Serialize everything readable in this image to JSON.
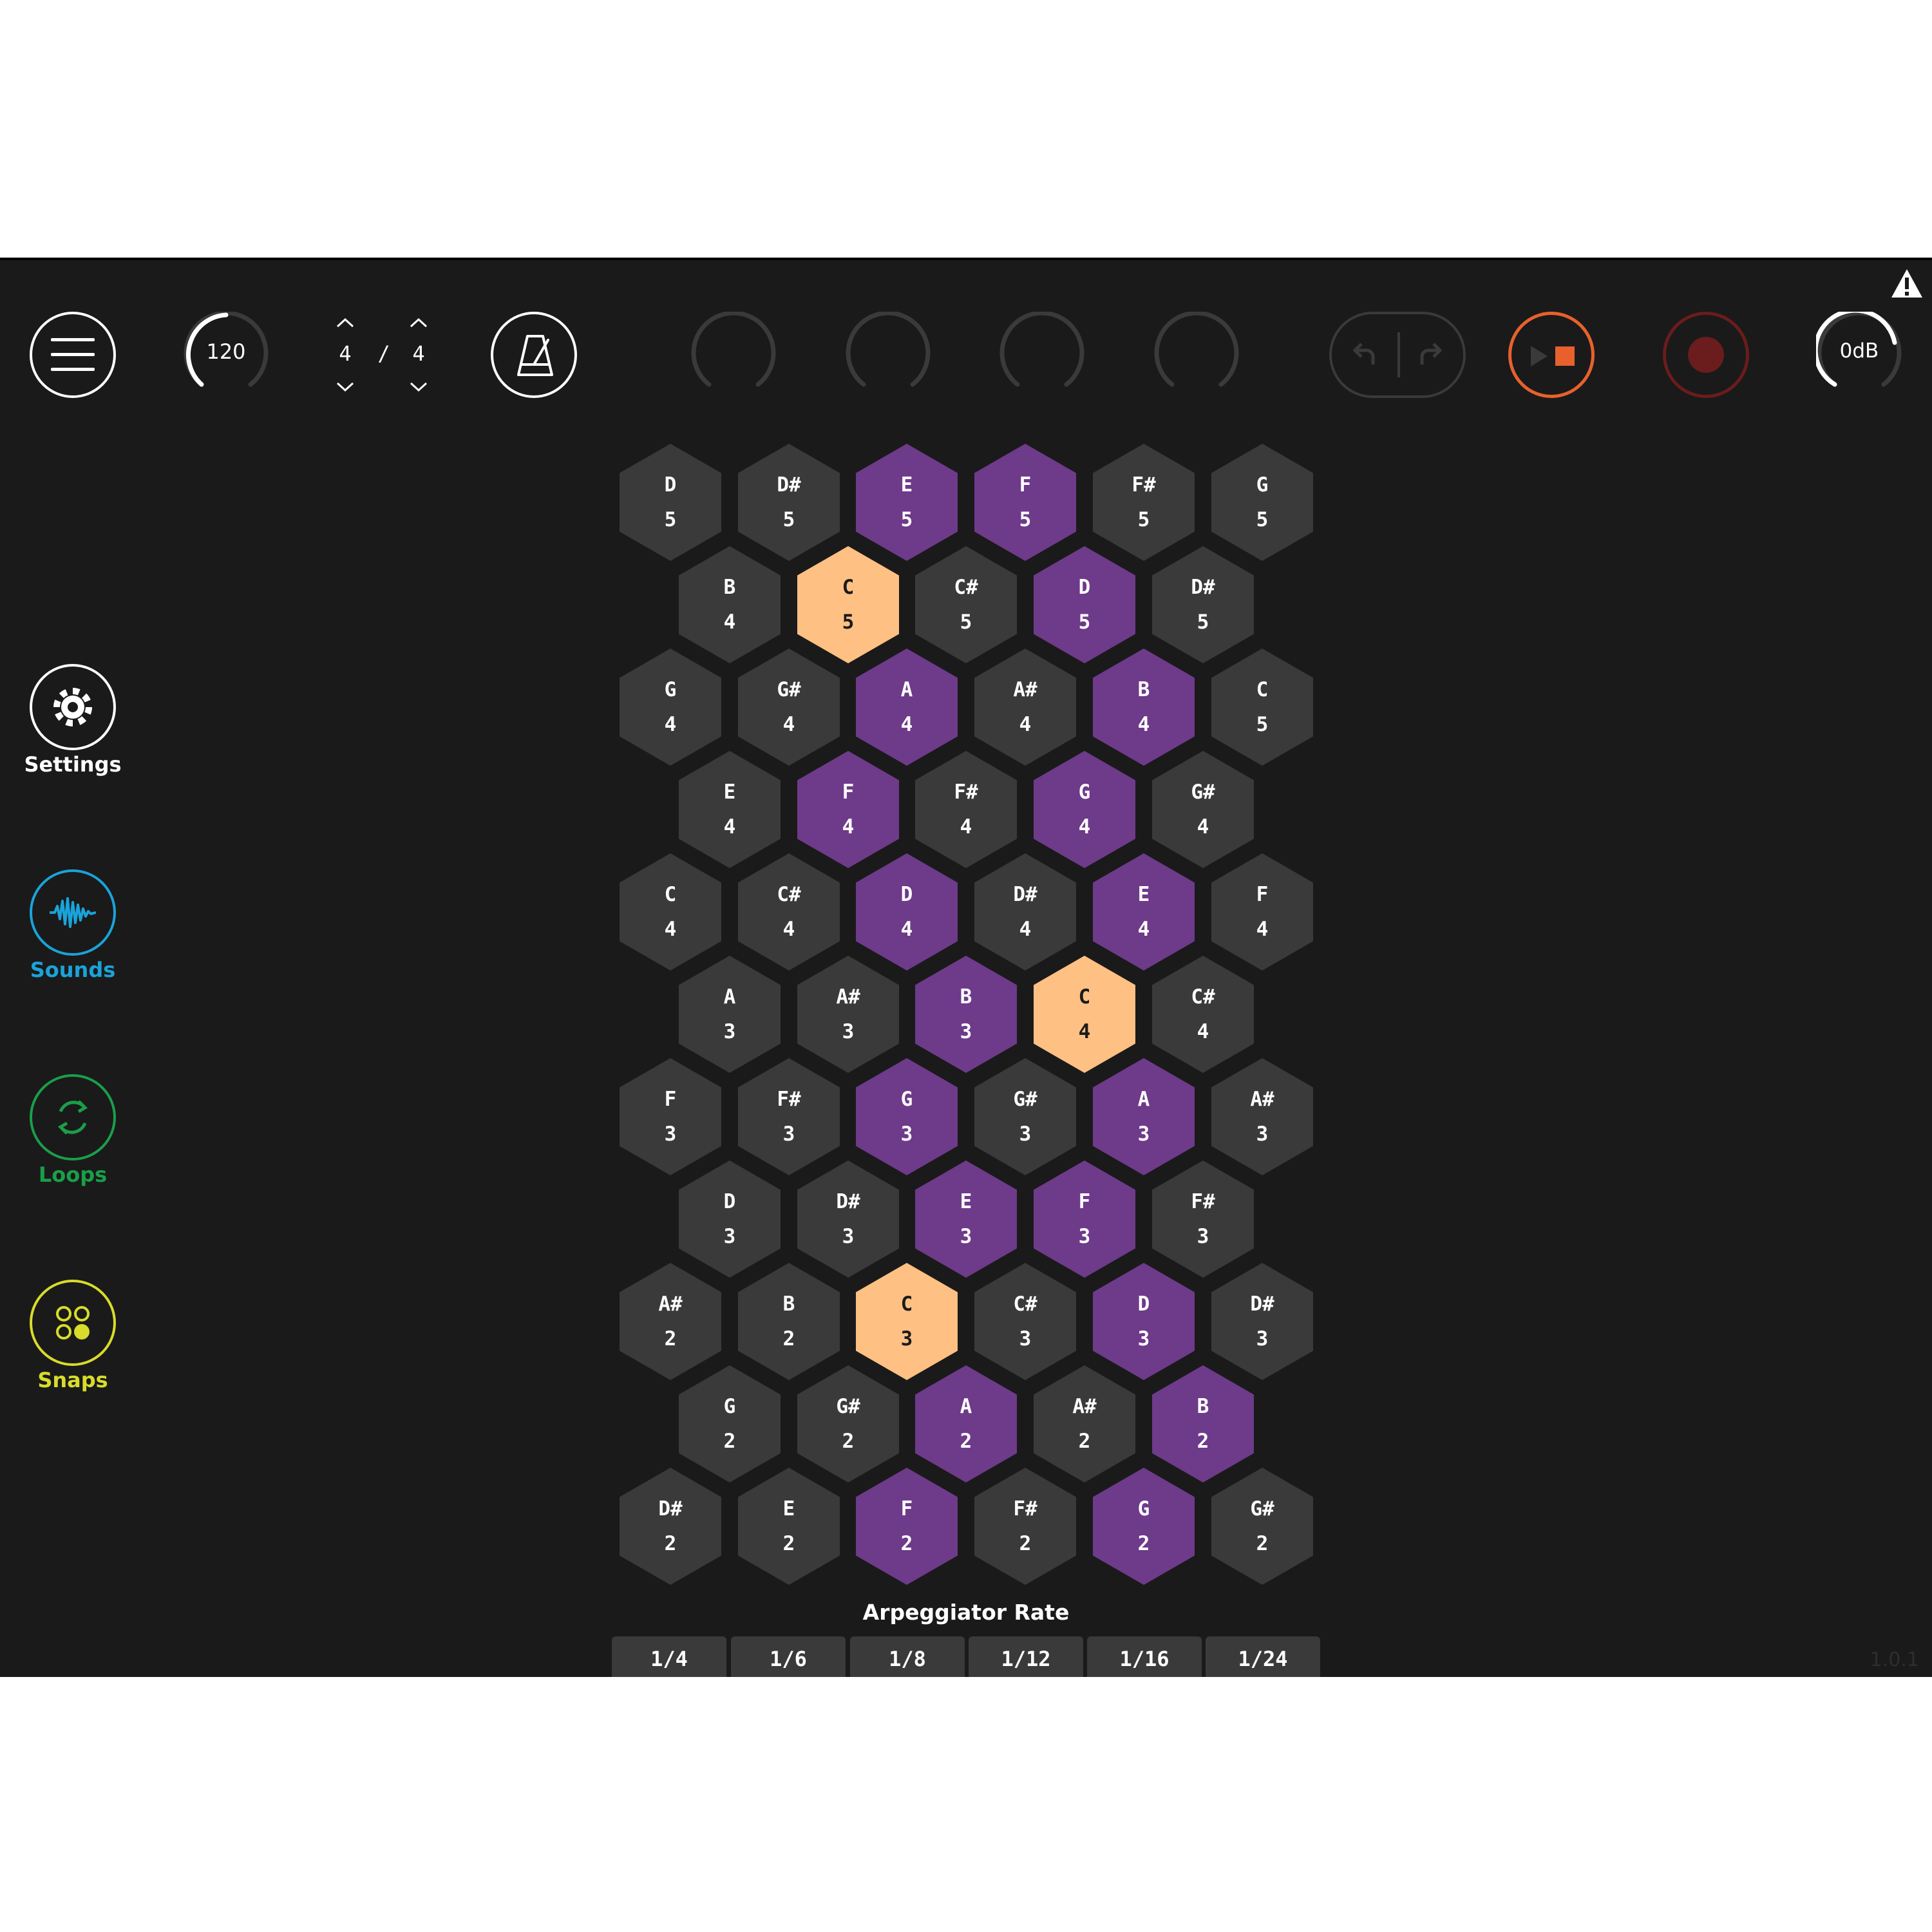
{
  "toolbar": {
    "tempo": "120",
    "time_signature": {
      "numerator": "4",
      "separator": "/",
      "denominator": "4"
    },
    "volume": "0dB"
  },
  "nav": {
    "settings": "Settings",
    "sounds": "Sounds",
    "loops": "Loops",
    "snaps": "Snaps"
  },
  "colors": {
    "background": "#1a1a1a",
    "hex_default": "#3a3a3a",
    "hex_scale": "#6e3a8a",
    "hex_root": "#ffc083",
    "sounds": "#1aa3d9",
    "loops": "#1a9e4a",
    "snaps": "#d8dc2a",
    "play_stop": "#e8612c",
    "record": "#6b1c1c"
  },
  "grid": {
    "rows": [
      [
        {
          "n": "D",
          "o": "5",
          "t": "n"
        },
        {
          "n": "D#",
          "o": "5",
          "t": "n"
        },
        {
          "n": "E",
          "o": "5",
          "t": "s"
        },
        {
          "n": "F",
          "o": "5",
          "t": "s"
        },
        {
          "n": "F#",
          "o": "5",
          "t": "n"
        },
        {
          "n": "G",
          "o": "5",
          "t": "n"
        }
      ],
      [
        {
          "n": "B",
          "o": "4",
          "t": "n"
        },
        {
          "n": "C",
          "o": "5",
          "t": "r"
        },
        {
          "n": "C#",
          "o": "5",
          "t": "n"
        },
        {
          "n": "D",
          "o": "5",
          "t": "s"
        },
        {
          "n": "D#",
          "o": "5",
          "t": "n"
        }
      ],
      [
        {
          "n": "G",
          "o": "4",
          "t": "n"
        },
        {
          "n": "G#",
          "o": "4",
          "t": "n"
        },
        {
          "n": "A",
          "o": "4",
          "t": "s"
        },
        {
          "n": "A#",
          "o": "4",
          "t": "n"
        },
        {
          "n": "B",
          "o": "4",
          "t": "s"
        },
        {
          "n": "C",
          "o": "5",
          "t": "n"
        }
      ],
      [
        {
          "n": "E",
          "o": "4",
          "t": "n"
        },
        {
          "n": "F",
          "o": "4",
          "t": "s"
        },
        {
          "n": "F#",
          "o": "4",
          "t": "n"
        },
        {
          "n": "G",
          "o": "4",
          "t": "s"
        },
        {
          "n": "G#",
          "o": "4",
          "t": "n"
        }
      ],
      [
        {
          "n": "C",
          "o": "4",
          "t": "n"
        },
        {
          "n": "C#",
          "o": "4",
          "t": "n"
        },
        {
          "n": "D",
          "o": "4",
          "t": "s"
        },
        {
          "n": "D#",
          "o": "4",
          "t": "n"
        },
        {
          "n": "E",
          "o": "4",
          "t": "s"
        },
        {
          "n": "F",
          "o": "4",
          "t": "n"
        }
      ],
      [
        {
          "n": "A",
          "o": "3",
          "t": "n"
        },
        {
          "n": "A#",
          "o": "3",
          "t": "n"
        },
        {
          "n": "B",
          "o": "3",
          "t": "s"
        },
        {
          "n": "C",
          "o": "4",
          "t": "r"
        },
        {
          "n": "C#",
          "o": "4",
          "t": "n"
        }
      ],
      [
        {
          "n": "F",
          "o": "3",
          "t": "n"
        },
        {
          "n": "F#",
          "o": "3",
          "t": "n"
        },
        {
          "n": "G",
          "o": "3",
          "t": "s"
        },
        {
          "n": "G#",
          "o": "3",
          "t": "n"
        },
        {
          "n": "A",
          "o": "3",
          "t": "s"
        },
        {
          "n": "A#",
          "o": "3",
          "t": "n"
        }
      ],
      [
        {
          "n": "D",
          "o": "3",
          "t": "n"
        },
        {
          "n": "D#",
          "o": "3",
          "t": "n"
        },
        {
          "n": "E",
          "o": "3",
          "t": "s"
        },
        {
          "n": "F",
          "o": "3",
          "t": "s"
        },
        {
          "n": "F#",
          "o": "3",
          "t": "n"
        }
      ],
      [
        {
          "n": "A#",
          "o": "2",
          "t": "n"
        },
        {
          "n": "B",
          "o": "2",
          "t": "n"
        },
        {
          "n": "C",
          "o": "3",
          "t": "r"
        },
        {
          "n": "C#",
          "o": "3",
          "t": "n"
        },
        {
          "n": "D",
          "o": "3",
          "t": "s"
        },
        {
          "n": "D#",
          "o": "3",
          "t": "n"
        }
      ],
      [
        {
          "n": "G",
          "o": "2",
          "t": "n"
        },
        {
          "n": "G#",
          "o": "2",
          "t": "n"
        },
        {
          "n": "A",
          "o": "2",
          "t": "s"
        },
        {
          "n": "A#",
          "o": "2",
          "t": "n"
        },
        {
          "n": "B",
          "o": "2",
          "t": "s"
        }
      ],
      [
        {
          "n": "D#",
          "o": "2",
          "t": "n"
        },
        {
          "n": "E",
          "o": "2",
          "t": "n"
        },
        {
          "n": "F",
          "o": "2",
          "t": "s"
        },
        {
          "n": "F#",
          "o": "2",
          "t": "n"
        },
        {
          "n": "G",
          "o": "2",
          "t": "s"
        },
        {
          "n": "G#",
          "o": "2",
          "t": "n"
        }
      ]
    ]
  },
  "arpeggiator": {
    "label": "Arpeggiator Rate",
    "rates": [
      "1/4",
      "1/6",
      "1/8",
      "1/12",
      "1/16",
      "1/24"
    ]
  },
  "version": "1.0.1"
}
